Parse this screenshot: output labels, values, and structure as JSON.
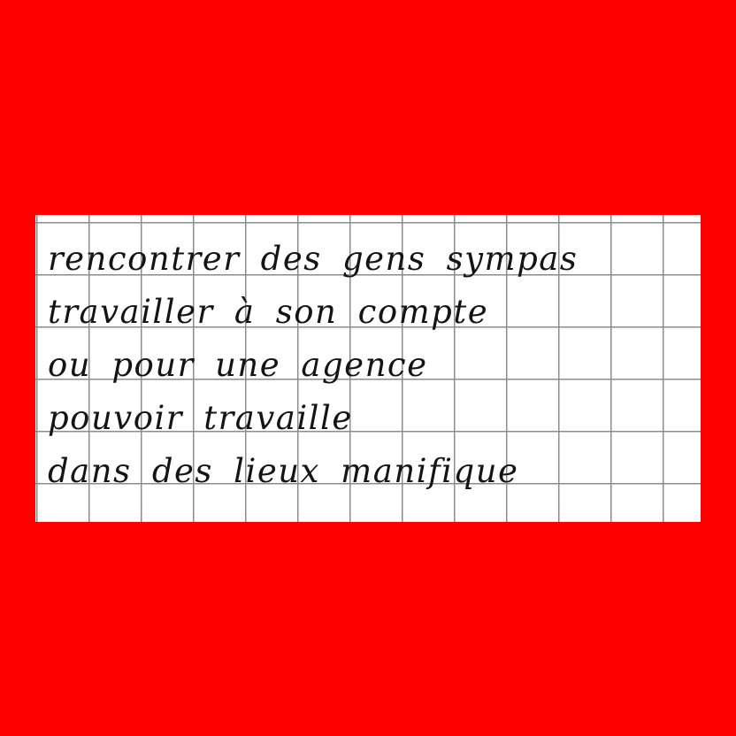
{
  "colors": {
    "background": "#ff0000",
    "paper": "#ffffff",
    "grid": "#8c8c8c",
    "ink": "#141414"
  },
  "note": {
    "lines": [
      "rencontrer des gens sympas",
      "travailler à son compte",
      "ou pour une agence",
      "pouvoir travaille",
      "dans des lieux manifique"
    ]
  }
}
